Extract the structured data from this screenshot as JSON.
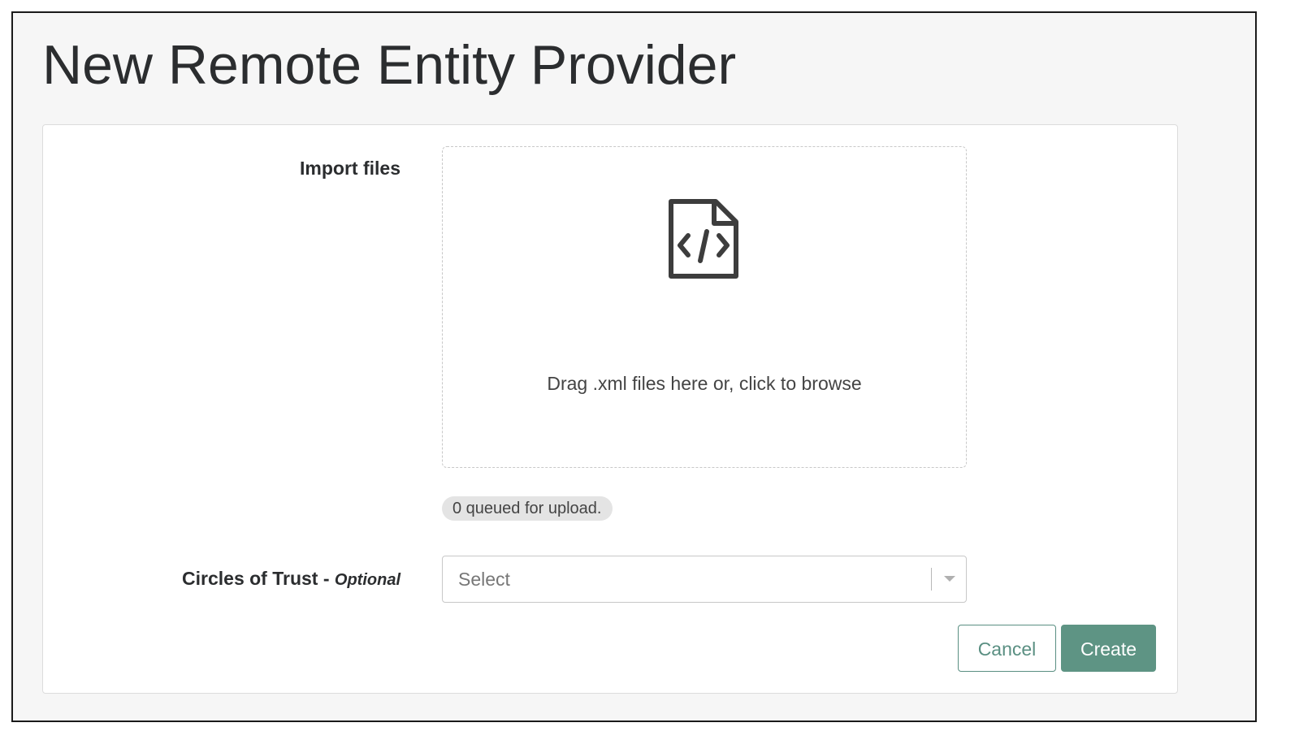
{
  "page": {
    "title": "New Remote Entity Provider"
  },
  "form": {
    "import_label": "Import files",
    "dropzone": {
      "icon": "file-code-icon",
      "text": "Drag .xml files here or, click to browse"
    },
    "queue_status": "0 queued for upload.",
    "circles_label": "Circles of Trust -",
    "circles_optional": "Optional",
    "circles_select": {
      "placeholder": "Select",
      "icon": "chevron-down-icon"
    }
  },
  "actions": {
    "cancel_label": "Cancel",
    "create_label": "Create"
  },
  "colors": {
    "primary": "#5e9484",
    "background": "#f6f6f6",
    "card": "#ffffff",
    "text": "#2b2d2f"
  }
}
